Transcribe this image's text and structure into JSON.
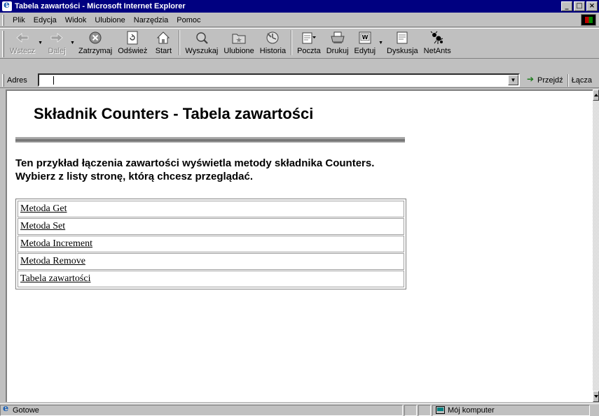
{
  "window": {
    "title": "Tabela zawartości - Microsoft Internet Explorer",
    "controls": [
      "_",
      "□",
      "×"
    ]
  },
  "menu": {
    "items": [
      {
        "label": "Plik",
        "key": "P"
      },
      {
        "label": "Edycja",
        "key": "E"
      },
      {
        "label": "Widok",
        "key": "W"
      },
      {
        "label": "Ulubione",
        "key": "b"
      },
      {
        "label": "Narzędzia",
        "key": "N"
      },
      {
        "label": "Pomoc",
        "key": "c"
      }
    ]
  },
  "toolbar": {
    "back": "Wstecz",
    "forward": "Dalej",
    "stop": "Zatrzymaj",
    "refresh": "Odśwież",
    "home": "Start",
    "search": "Wyszukaj",
    "favorites": "Ulubione",
    "history": "Historia",
    "mail": "Poczta",
    "print": "Drukuj",
    "edit": "Edytuj",
    "discuss": "Dyskusja",
    "netants": "NetAnts"
  },
  "address": {
    "label": "Adres",
    "value": "",
    "go": "Przejdź",
    "links": "Łącza"
  },
  "page": {
    "title": "Składnik Counters - Tabela zawartości",
    "intro": "Ten przykład łączenia zawartości wyświetla metody składnika Counters. Wybierz z listy stronę, którą chcesz przeglądać.",
    "toc": [
      "Metoda Get",
      "Metoda Set",
      "Metoda Increment",
      "Metoda Remove",
      "Tabela zawartości"
    ]
  },
  "status": {
    "text": "Gotowe",
    "zone": "Mój komputer"
  }
}
